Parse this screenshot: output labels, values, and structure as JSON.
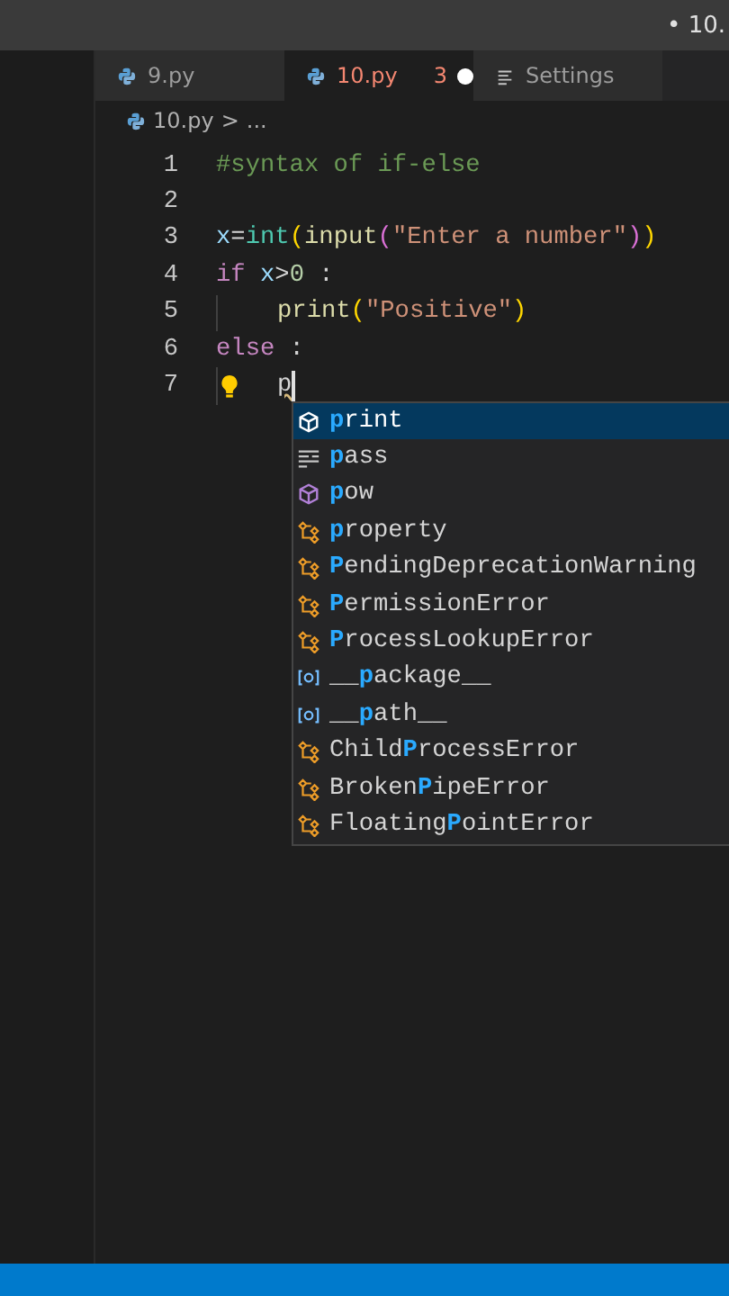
{
  "title_bar": {
    "title": "• 10."
  },
  "tabs": [
    {
      "label": "9.py",
      "kind": "file",
      "selected": false,
      "has_errors": false,
      "modified": false
    },
    {
      "label": "10.py",
      "kind": "file",
      "selected": true,
      "has_errors": true,
      "error_count": "3",
      "modified": true
    },
    {
      "label": "Settings",
      "kind": "settings",
      "selected": false,
      "has_errors": false,
      "modified": false
    }
  ],
  "breadcrumb": {
    "file": "10.py",
    "separator": ">",
    "rest": "..."
  },
  "editor": {
    "lines": [
      {
        "number": "1",
        "tokens": [
          {
            "text": "#syntax of if-else",
            "kind": "comment"
          }
        ]
      },
      {
        "number": "2"
      },
      {
        "number": "3",
        "tokens": [
          {
            "text": "x",
            "kind": "variable"
          },
          {
            "text": "=",
            "kind": "plain"
          },
          {
            "text": "int",
            "kind": "class"
          },
          {
            "text": "(",
            "kind": "bracket1"
          },
          {
            "text": "input",
            "kind": "function"
          },
          {
            "text": "(",
            "kind": "bracket2"
          },
          {
            "text": "\"Enter a number\"",
            "kind": "string"
          },
          {
            "text": ")",
            "kind": "bracket2"
          },
          {
            "text": ")",
            "kind": "bracket1"
          }
        ]
      },
      {
        "number": "4",
        "tokens": [
          {
            "text": "if",
            "kind": "keyword"
          },
          {
            "text": " x",
            "kind": "variable"
          },
          {
            "text": ">",
            "kind": "plain"
          },
          {
            "text": "0",
            "kind": "number"
          },
          {
            "text": " :",
            "kind": "plain"
          }
        ],
        "children": [
          {
            "number": "5",
            "tokens": [
              {
                "text": "print",
                "kind": "function"
              },
              {
                "text": "(",
                "kind": "bracket1"
              },
              {
                "text": "\"Positive\"",
                "kind": "string"
              },
              {
                "text": ")",
                "kind": "bracket1"
              }
            ]
          }
        ]
      },
      {
        "number": "6",
        "tokens": [
          {
            "text": "else",
            "kind": "keyword"
          },
          {
            "text": " :",
            "kind": "plain"
          }
        ],
        "children": [
          {
            "number": "7",
            "lightbulb": true,
            "cursor": true,
            "tokens": [
              {
                "text": "p",
                "kind": "typed"
              }
            ]
          }
        ]
      }
    ]
  },
  "suggestions": [
    {
      "kind": "method",
      "selected": true,
      "parts": [
        {
          "text": "p",
          "matched": true
        },
        {
          "text": "rint",
          "matched": false
        }
      ]
    },
    {
      "kind": "snippet",
      "selected": false,
      "parts": [
        {
          "text": "p",
          "matched": true
        },
        {
          "text": "ass",
          "matched": false
        }
      ]
    },
    {
      "kind": "method",
      "selected": false,
      "parts": [
        {
          "text": "p",
          "matched": true
        },
        {
          "text": "ow",
          "matched": false
        }
      ]
    },
    {
      "kind": "class",
      "selected": false,
      "parts": [
        {
          "text": "p",
          "matched": true
        },
        {
          "text": "roperty",
          "matched": false
        }
      ]
    },
    {
      "kind": "class",
      "selected": false,
      "parts": [
        {
          "text": "P",
          "matched": true
        },
        {
          "text": "endingDeprecationWarning",
          "matched": false
        }
      ]
    },
    {
      "kind": "class",
      "selected": false,
      "parts": [
        {
          "text": "P",
          "matched": true
        },
        {
          "text": "ermissionError",
          "matched": false
        }
      ]
    },
    {
      "kind": "class",
      "selected": false,
      "parts": [
        {
          "text": "P",
          "matched": true
        },
        {
          "text": "rocessLookupError",
          "matched": false
        }
      ]
    },
    {
      "kind": "variable",
      "selected": false,
      "parts": [
        {
          "text": "__",
          "matched": false
        },
        {
          "text": "p",
          "matched": true
        },
        {
          "text": "ackage__",
          "matched": false
        }
      ]
    },
    {
      "kind": "variable",
      "selected": false,
      "parts": [
        {
          "text": "__",
          "matched": false
        },
        {
          "text": "p",
          "matched": true
        },
        {
          "text": "ath__",
          "matched": false
        }
      ]
    },
    {
      "kind": "class",
      "selected": false,
      "parts": [
        {
          "text": "Child",
          "matched": false
        },
        {
          "text": "P",
          "matched": true
        },
        {
          "text": "rocessError",
          "matched": false
        }
      ]
    },
    {
      "kind": "class",
      "selected": false,
      "parts": [
        {
          "text": "Broken",
          "matched": false
        },
        {
          "text": "P",
          "matched": true
        },
        {
          "text": "ipeError",
          "matched": false
        }
      ]
    },
    {
      "kind": "class",
      "selected": false,
      "parts": [
        {
          "text": "Floating",
          "matched": false
        },
        {
          "text": "P",
          "matched": true
        },
        {
          "text": "ointError",
          "matched": false
        }
      ]
    }
  ]
}
